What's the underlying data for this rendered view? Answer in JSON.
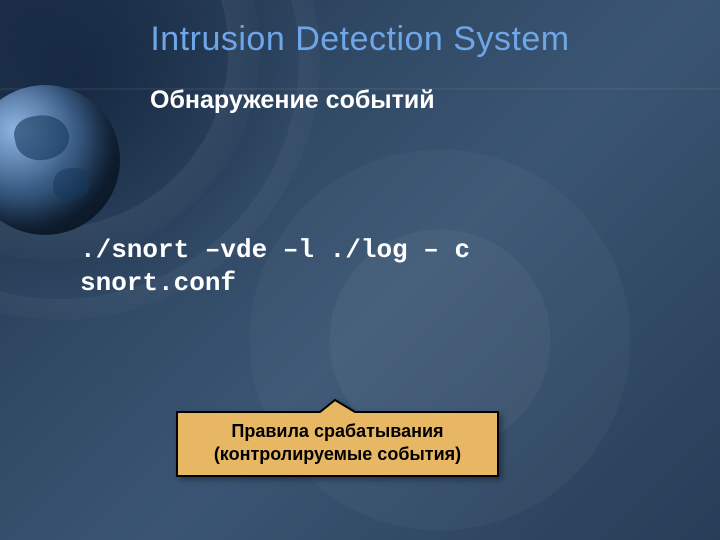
{
  "title": "Intrusion Detection System",
  "subtitle": "Обнаружение событий",
  "command": "./snort –vde –l ./log – c snort.conf",
  "callout": {
    "line1": "Правила срабатывания",
    "line2": "(контролируемые события)"
  },
  "colors": {
    "title": "#6fa6e8",
    "callout_fill": "#e8b763",
    "callout_stroke": "#000000",
    "background_base": "#314a66"
  }
}
